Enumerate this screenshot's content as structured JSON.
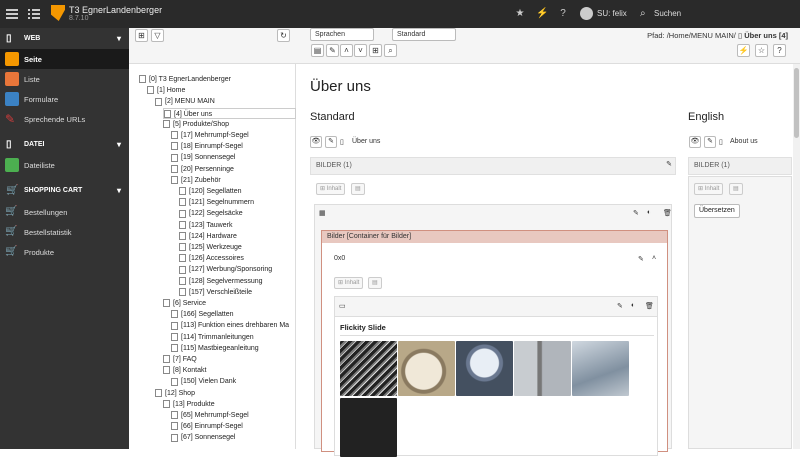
{
  "topbar": {
    "site_name": "T3 EgnerLandenberger",
    "version": "8.7.10",
    "user": "SU: felix",
    "search_label": "Suchen"
  },
  "sidebar": {
    "sections": [
      {
        "label": "WEB",
        "items": [
          "Seite",
          "Liste",
          "Formulare",
          "Sprechende URLs"
        ]
      },
      {
        "label": "DATEI",
        "items": [
          "Dateiliste"
        ]
      },
      {
        "label": "SHOPPING CART",
        "items": [
          "Bestellungen",
          "Bestellstatistik",
          "Produkte"
        ]
      }
    ],
    "colors": {
      "seite": "#f49700",
      "liste": "#e8763a",
      "formulare": "#3b82c4",
      "urls": "#d13c3c",
      "dateiliste": "#4caf50"
    }
  },
  "tree": {
    "nodes": [
      {
        "label": "[0] T3 EgnerLandenberger",
        "depth": 0
      },
      {
        "label": "[1] Home",
        "depth": 1
      },
      {
        "label": "[2] MENU MAIN",
        "depth": 2
      },
      {
        "label": "[4] Über uns",
        "depth": 3,
        "selected": true
      },
      {
        "label": "[5] Produkte/Shop",
        "depth": 3
      },
      {
        "label": "[17] Mehrrumpf-Segel",
        "depth": 4
      },
      {
        "label": "[18] Einrumpf-Segel",
        "depth": 4
      },
      {
        "label": "[19] Sonnensegel",
        "depth": 4
      },
      {
        "label": "[20] Persenninge",
        "depth": 4
      },
      {
        "label": "[21] Zubehör",
        "depth": 4
      },
      {
        "label": "[120] Segellatten",
        "depth": 5
      },
      {
        "label": "[121] Segelnummern",
        "depth": 5
      },
      {
        "label": "[122] Segelsäcke",
        "depth": 5
      },
      {
        "label": "[123] Tauwerk",
        "depth": 5
      },
      {
        "label": "[124] Hardware",
        "depth": 5
      },
      {
        "label": "[125] Werkzeuge",
        "depth": 5
      },
      {
        "label": "[126] Accessoires",
        "depth": 5
      },
      {
        "label": "[127] Werbung/Sponsoring",
        "depth": 5
      },
      {
        "label": "[128] Segelvermessung",
        "depth": 5
      },
      {
        "label": "[157] Verschleißteile",
        "depth": 5
      },
      {
        "label": "[6] Service",
        "depth": 3
      },
      {
        "label": "[166] Segellatten",
        "depth": 4
      },
      {
        "label": "[113] Funktion eines drehbaren Ma",
        "depth": 4
      },
      {
        "label": "[114] Trimmanleitungen",
        "depth": 4
      },
      {
        "label": "[115] Mastbiegeanleitung",
        "depth": 4
      },
      {
        "label": "[7] FAQ",
        "depth": 3
      },
      {
        "label": "[8] Kontakt",
        "depth": 3
      },
      {
        "label": "[150] Vielen Dank",
        "depth": 4
      },
      {
        "label": "[12] Shop",
        "depth": 2
      },
      {
        "label": "[13] Produkte",
        "depth": 3
      },
      {
        "label": "[65] Mehrrumpf-Segel",
        "depth": 4
      },
      {
        "label": "[66] Einrumpf-Segel",
        "depth": 4
      },
      {
        "label": "[67] Sonnensegel",
        "depth": 4
      }
    ]
  },
  "toolbar": {
    "language_select": "Sprachen",
    "view_select": "Standard",
    "path_prefix": "Pfad: /Home/MENU MAIN/",
    "path_page": "Über uns [4]"
  },
  "page": {
    "title": "Über uns",
    "default_col": {
      "title": "Standard",
      "page_name": "Über uns",
      "column_header": "BILDER (1)",
      "inhalt_btn": "Inhalt",
      "container_title": "Bilder [Container für Bilder]",
      "sub_column": "0x0",
      "inhalt_btn2": "Inhalt",
      "slide_title": "Flickity Slide"
    },
    "english_col": {
      "title": "English",
      "page_name": "About us",
      "column_header": "BILDER (1)",
      "inhalt_btn": "Inhalt",
      "translate_btn": "Übersetzen"
    }
  }
}
